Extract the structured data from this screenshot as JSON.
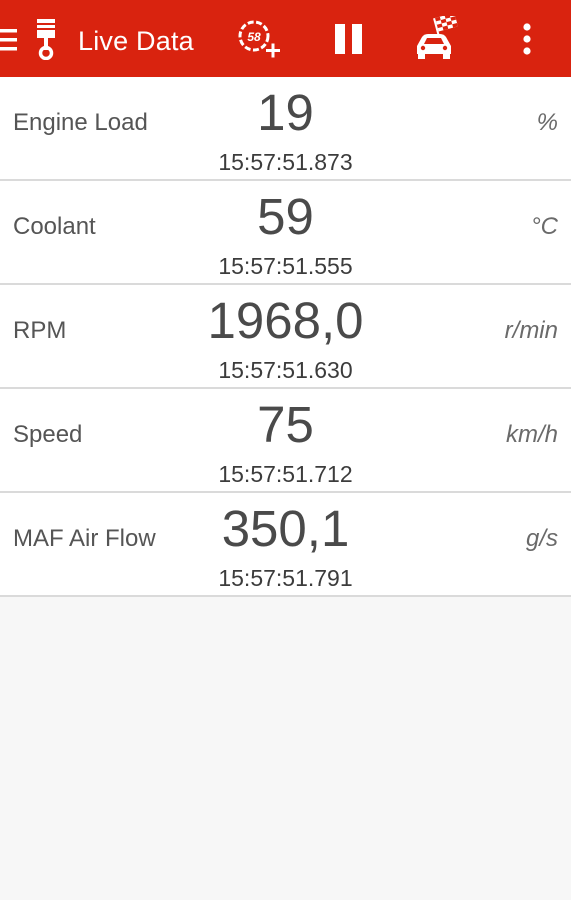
{
  "appbar": {
    "title": "Live Data",
    "background_color": "#d9230f",
    "icons": {
      "menu": "hamburger-icon",
      "logo": "piston-icon",
      "add_gauge": "gauge-add-icon",
      "add_gauge_badge": "58",
      "pause": "pause-icon",
      "race": "race-car-flag-icon",
      "more": "overflow-menu-icon"
    }
  },
  "rows": [
    {
      "label": "Engine Load",
      "value": "19",
      "time": "15:57:51.873",
      "unit": "%"
    },
    {
      "label": "Coolant",
      "value": "59",
      "time": "15:57:51.555",
      "unit": "°C"
    },
    {
      "label": "RPM",
      "value": "1968,0",
      "time": "15:57:51.630",
      "unit": "r/min"
    },
    {
      "label": "Speed",
      "value": "75",
      "time": "15:57:51.712",
      "unit": "km/h"
    },
    {
      "label": "MAF Air Flow",
      "value": "350,1",
      "time": "15:57:51.791",
      "unit": "g/s"
    }
  ]
}
